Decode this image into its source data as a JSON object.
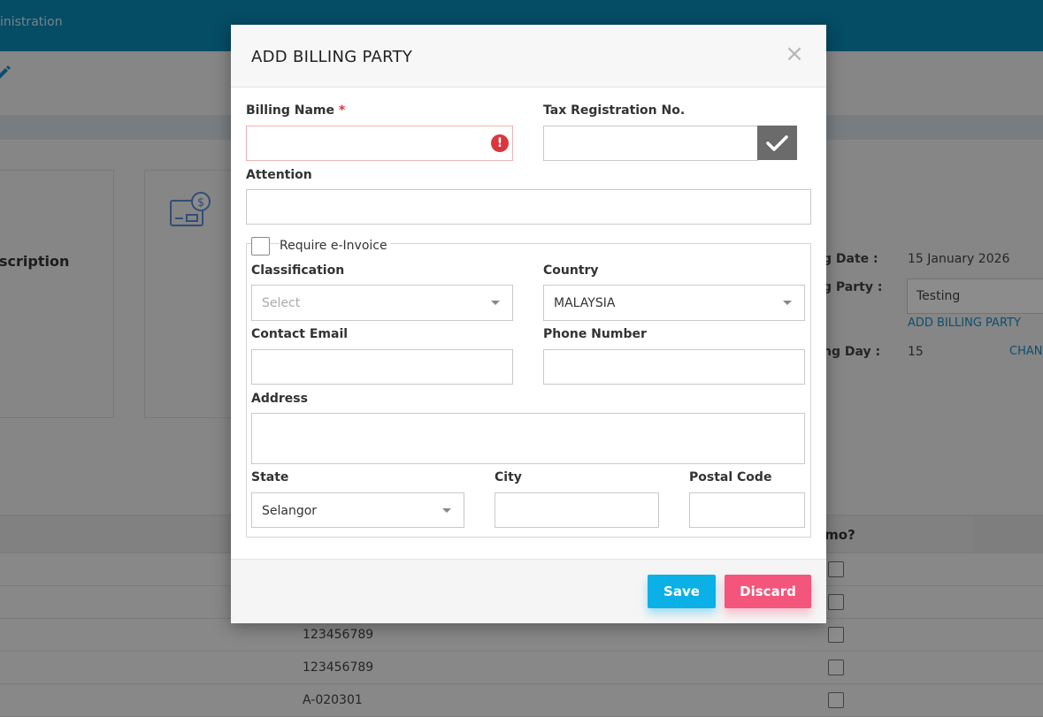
{
  "background": {
    "breadcrumb": "inistration",
    "description_heading": "scription",
    "billing_date_label": "g Date :",
    "billing_date_value": "15 January 2026",
    "billing_party_label": "g Party :",
    "billing_party_value": "Testing",
    "add_billing_party_link": "ADD BILLING PARTY",
    "billing_day_label": "ng Day :",
    "billing_day_value": "15",
    "change_link": "CHAN",
    "table_header_memo": "emo?",
    "rows": [
      {
        "value": ""
      },
      {
        "value": ""
      },
      {
        "value": "123456789"
      },
      {
        "value": "123456789"
      },
      {
        "value": "A-020301"
      }
    ]
  },
  "modal": {
    "title": "ADD BILLING PARTY",
    "close_symbol": "×",
    "billing_name": {
      "label": "Billing Name",
      "required_mark": "*",
      "value": "",
      "error_symbol": "!"
    },
    "tax_registration": {
      "label": "Tax Registration No.",
      "value": ""
    },
    "attention": {
      "label": "Attention",
      "value": ""
    },
    "require_einvoice": {
      "label": "Require e-Invoice",
      "checked": false
    },
    "classification": {
      "label": "Classification",
      "placeholder": "Select"
    },
    "country": {
      "label": "Country",
      "value": "MALAYSIA"
    },
    "contact_email": {
      "label": "Contact Email",
      "value": ""
    },
    "phone_number": {
      "label": "Phone Number",
      "value": ""
    },
    "address": {
      "label": "Address",
      "value": ""
    },
    "state": {
      "label": "State",
      "value": "Selangor"
    },
    "city": {
      "label": "City",
      "value": ""
    },
    "postal_code": {
      "label": "Postal Code",
      "value": ""
    },
    "save_label": "Save",
    "discard_label": "Discard"
  },
  "colors": {
    "topbar": "#0a8ab8",
    "save": "#0ab0e6",
    "discard": "#f4557a",
    "error": "#d9363e"
  }
}
